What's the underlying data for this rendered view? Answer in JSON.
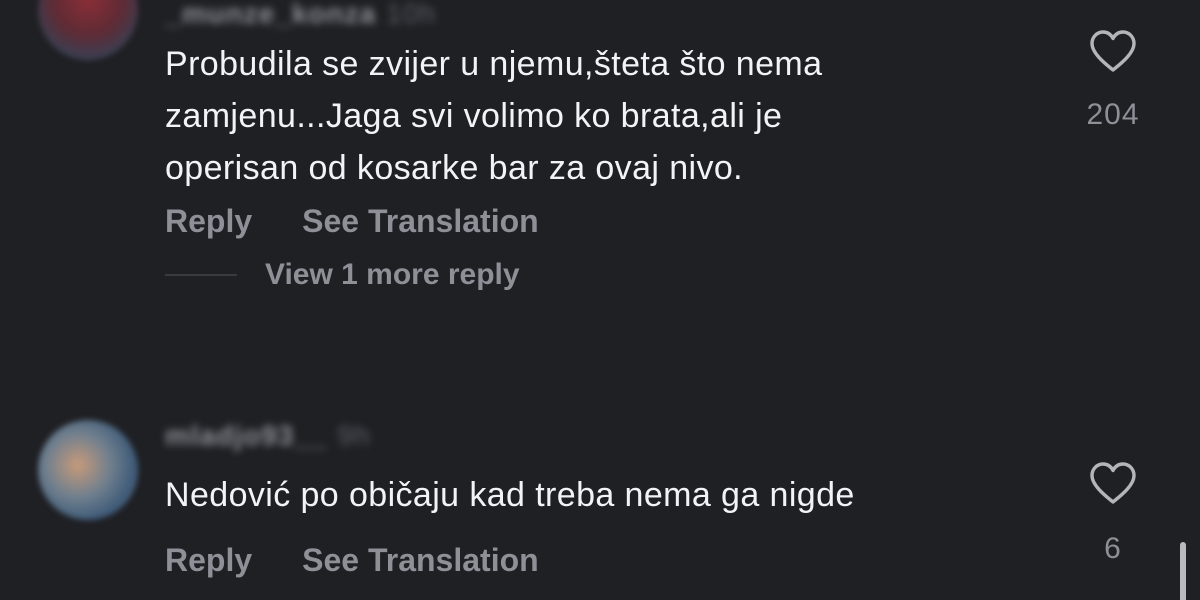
{
  "comments": [
    {
      "username": "_munze_konza",
      "time": "10h",
      "text_lines": [
        "Probudila se zvijer u njemu,šteta što nema",
        "zamjenu...Jaga svi volimo ko brata,ali je",
        "operisan od kosarke bar za ovaj nivo."
      ],
      "reply_label": "Reply",
      "translate_label": "See Translation",
      "like_count": "204",
      "like_icon": "heart-outline-icon",
      "view_replies_label": "View 1 more reply"
    },
    {
      "username": "mladjo93__",
      "time": "9h",
      "text_lines": [
        "Nedović po običaju kad treba nema ga nigde"
      ],
      "reply_label": "Reply",
      "translate_label": "See Translation",
      "like_count": "6",
      "like_icon": "heart-outline-icon"
    }
  ],
  "colors": {
    "background": "#1f2024",
    "text_primary": "#f3f3f5",
    "text_secondary": "#8e8f97"
  }
}
